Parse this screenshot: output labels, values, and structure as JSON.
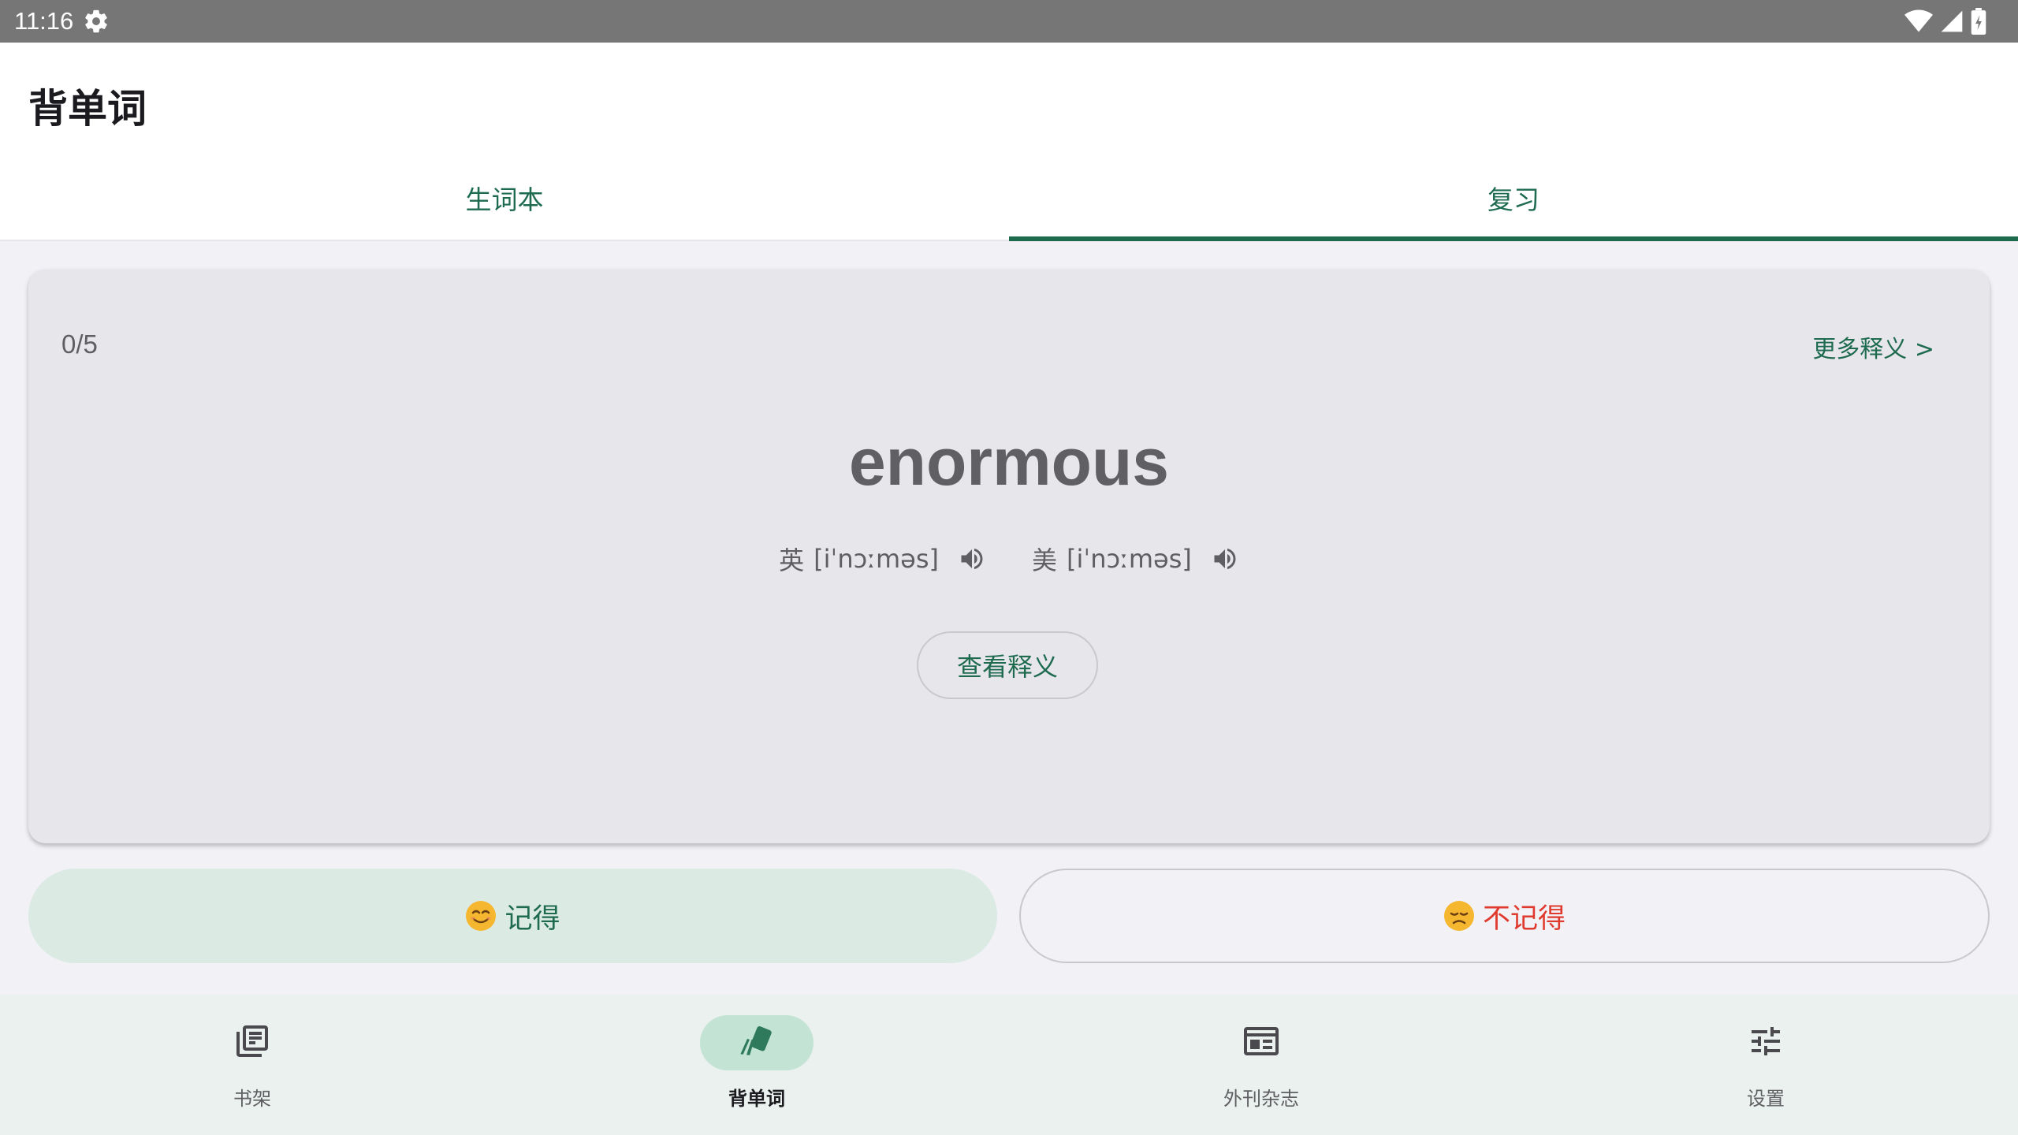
{
  "status_bar": {
    "time": "11:16",
    "icons": [
      "gear-icon",
      "wifi-icon",
      "signal-icon",
      "battery-icon"
    ]
  },
  "app_bar": {
    "title": "背单词"
  },
  "tabs": [
    {
      "label": "生词本",
      "active": false
    },
    {
      "label": "复习",
      "active": true
    }
  ],
  "card": {
    "progress": "0/5",
    "more_link": "更多释义 >",
    "word": "enormous",
    "phonetics": {
      "uk_label": "英",
      "uk_ipa": "[iˈnɔːməs]",
      "us_label": "美",
      "us_ipa": "[iˈnɔːməs]"
    },
    "view_button": "查看释义"
  },
  "actions": {
    "remember": "记得",
    "forget": "不记得"
  },
  "bottom_nav": [
    {
      "label": "书架",
      "icon": "library-books-icon",
      "active": false
    },
    {
      "label": "背单词",
      "icon": "flashcards-icon",
      "active": true
    },
    {
      "label": "外刊杂志",
      "icon": "newspaper-icon",
      "active": false
    },
    {
      "label": "设置",
      "icon": "tune-icon",
      "active": false
    }
  ],
  "colors": {
    "accent": "#1e6b4f",
    "forget_red": "#e03a2e",
    "card_bg": "#e7e6eb",
    "page_bg": "#f1f1f6",
    "nav_bg": "#eaf1ee",
    "status_bar": "#767676"
  }
}
